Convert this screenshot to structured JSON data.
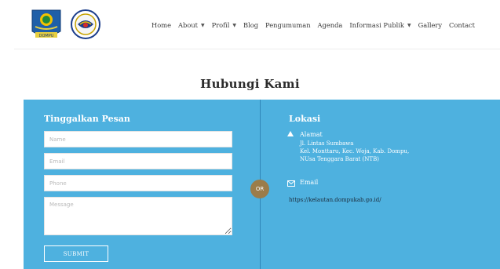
{
  "header": {
    "logo_primary_icon": "dompu-regency-crest-icon",
    "logo_primary_text": "DOMPU",
    "logo_secondary_icon": "ministry-emblem-icon",
    "nav": [
      {
        "label": "Home",
        "has_dropdown": false
      },
      {
        "label": "About",
        "has_dropdown": true
      },
      {
        "label": "Profil",
        "has_dropdown": true
      },
      {
        "label": "Blog",
        "has_dropdown": false
      },
      {
        "label": "Pengumuman",
        "has_dropdown": false
      },
      {
        "label": "Agenda",
        "has_dropdown": false
      },
      {
        "label": "Informasi Publik",
        "has_dropdown": true
      },
      {
        "label": "Gallery",
        "has_dropdown": false
      },
      {
        "label": "Contact",
        "has_dropdown": false
      }
    ]
  },
  "page": {
    "title": "Hubungi Kami"
  },
  "contact_form": {
    "title": "Tinggalkan Pesan",
    "name_placeholder": "Name",
    "email_placeholder": "Email",
    "phone_placeholder": "Phone",
    "message_placeholder": "Message",
    "submit_label": "SUBMIT"
  },
  "or_label": "OR",
  "location": {
    "title": "Lokasi",
    "address_label": "Alamat",
    "address_lines": [
      "Jl. Lintas Sumbawa",
      "Kel. Monttaru, Kec. Woja, Kab. Dompu,",
      "NUsa Tenggara Barat (NTB)"
    ],
    "email_label": "Email",
    "website": "https://kelautan.dompukab.go.id/"
  },
  "colors": {
    "panel_bg": "#4eb1df",
    "or_badge": "#9b7c4a",
    "divider": "#2f86b8"
  }
}
